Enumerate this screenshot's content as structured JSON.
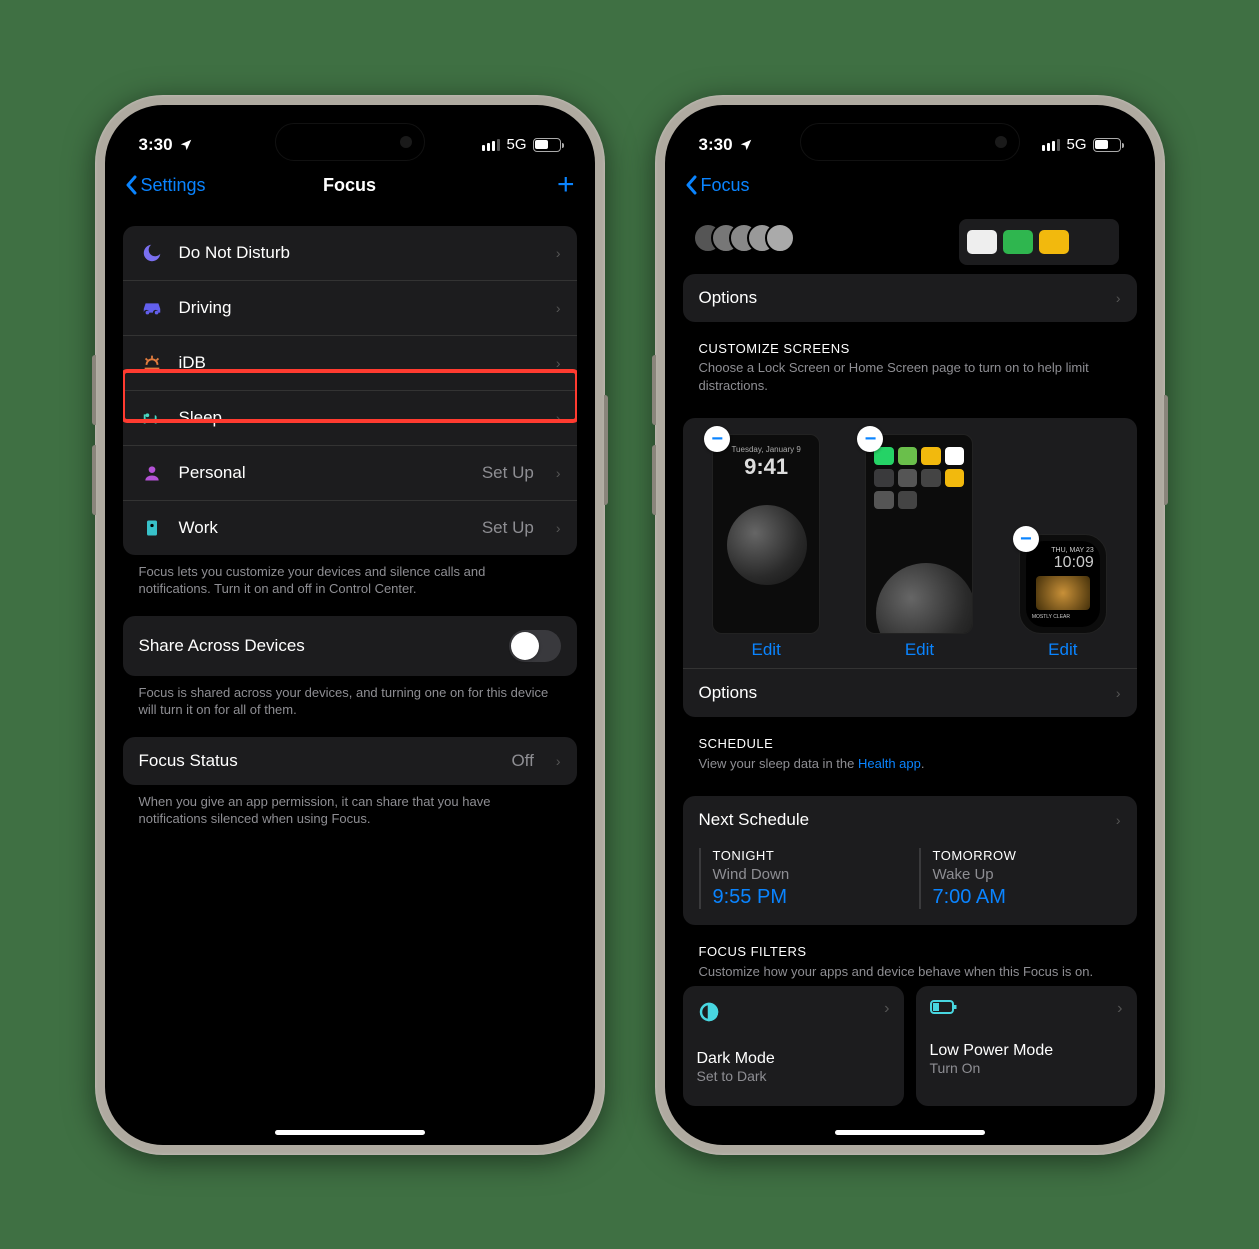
{
  "status": {
    "time": "3:30",
    "network": "5G"
  },
  "left": {
    "back": "Settings",
    "title": "Focus",
    "list": [
      {
        "label": "Do Not Disturb",
        "icon": "moon",
        "color": "#7a6ff0"
      },
      {
        "label": "Driving",
        "icon": "car",
        "color": "#625fed"
      },
      {
        "label": "iDB",
        "icon": "sunrise",
        "color": "#e07b3e"
      },
      {
        "label": "Sleep",
        "icon": "bed",
        "color": "#48d6c1",
        "highlight": true
      },
      {
        "label": "Personal",
        "icon": "person",
        "color": "#b452d6",
        "value": "Set Up"
      },
      {
        "label": "Work",
        "icon": "badge",
        "color": "#38c1c9",
        "value": "Set Up"
      }
    ],
    "list_footer": "Focus lets you customize your devices and silence calls and notifications. Turn it on and off in Control Center.",
    "share": {
      "label": "Share Across Devices",
      "footer": "Focus is shared across your devices, and turning one on for this device will turn it on for all of them."
    },
    "status_row": {
      "label": "Focus Status",
      "value": "Off",
      "footer": "When you give an app permission, it can share that you have notifications silenced when using Focus."
    }
  },
  "right": {
    "back": "Focus",
    "options": "Options",
    "customize": {
      "title": "CUSTOMIZE SCREENS",
      "sub": "Choose a Lock Screen or Home Screen page to turn on to help limit distractions.",
      "edit": "Edit",
      "lock_time": "9:41",
      "watch_date": "THU, MAY 23",
      "watch_time": "10:09",
      "watch_cond": "MOSTLY CLEAR"
    },
    "schedule": {
      "title": "SCHEDULE",
      "sub_pre": "View your sleep data in the ",
      "link": "Health app",
      "next": "Next Schedule",
      "tonight": {
        "title": "TONIGHT",
        "sub": "Wind Down",
        "time": "9:55 PM"
      },
      "tomorrow": {
        "title": "TOMORROW",
        "sub": "Wake Up",
        "time": "7:00 AM"
      }
    },
    "filters": {
      "title": "FOCUS FILTERS",
      "sub": "Customize how your apps and device behave when this Focus is on.",
      "dark": {
        "title": "Dark Mode",
        "sub": "Set to Dark"
      },
      "lpm": {
        "title": "Low Power Mode",
        "sub": "Turn On"
      }
    }
  }
}
